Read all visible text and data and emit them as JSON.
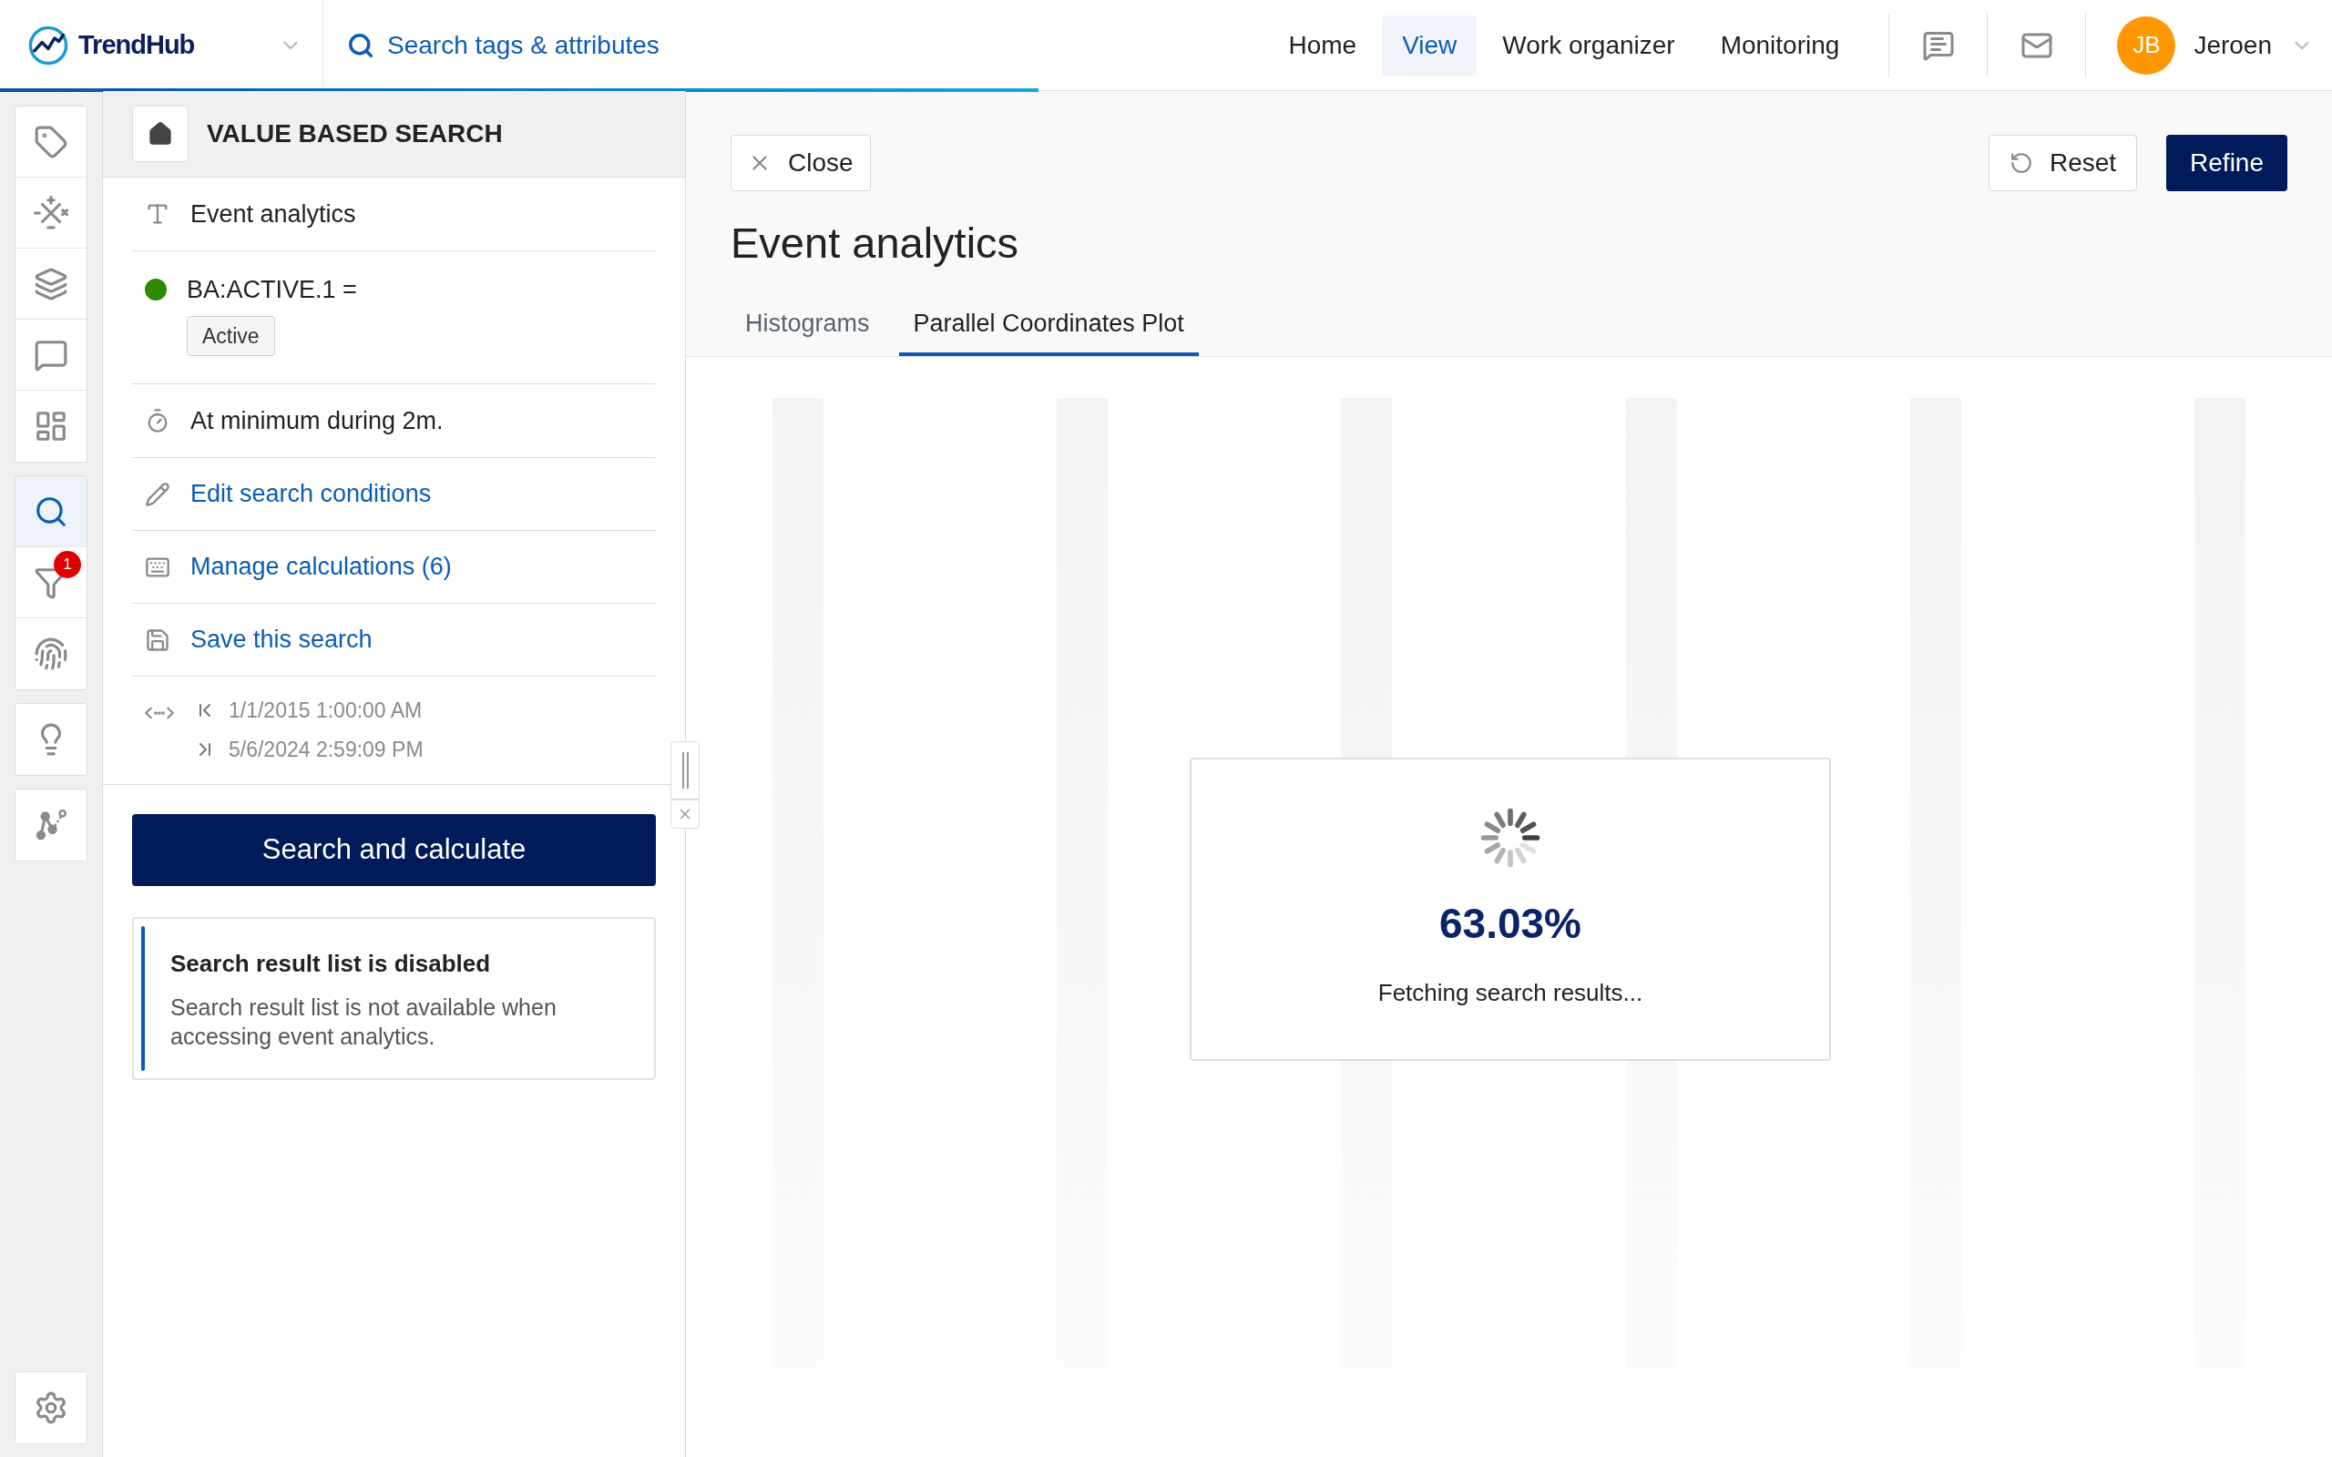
{
  "app": {
    "name": "TrendHub"
  },
  "search": {
    "placeholder": "Search tags & attributes"
  },
  "nav": [
    {
      "label": "Home",
      "selected": false
    },
    {
      "label": "View",
      "selected": true
    },
    {
      "label": "Work organizer",
      "selected": false
    },
    {
      "label": "Monitoring",
      "selected": false
    }
  ],
  "user": {
    "initials": "JB",
    "name": "Jeroen"
  },
  "sidebar": {
    "groups": [
      [
        {
          "kind": "tag",
          "selected": false
        },
        {
          "kind": "calculator",
          "selected": false
        },
        {
          "kind": "layers",
          "selected": false
        },
        {
          "kind": "comment",
          "selected": false
        },
        {
          "kind": "dashboard",
          "selected": false
        }
      ],
      [
        {
          "kind": "search",
          "selected": true
        },
        {
          "kind": "filter",
          "selected": false,
          "badge": "1"
        },
        {
          "kind": "fingerprint",
          "selected": false
        }
      ],
      [
        {
          "kind": "lightbulb",
          "selected": false
        }
      ],
      [
        {
          "kind": "graph",
          "selected": false
        }
      ]
    ],
    "footer": {
      "kind": "settings",
      "selected": false
    }
  },
  "panel": {
    "title": "VALUE BASED SEARCH",
    "items": [
      {
        "kind": "title",
        "text": "Event analytics"
      },
      {
        "kind": "condition",
        "color": "#2e8b00",
        "text": "BA:ACTIVE.1 =",
        "value": "Active"
      },
      {
        "kind": "duration",
        "text": "At minimum during 2m."
      },
      {
        "kind": "edit",
        "text": "Edit search conditions"
      },
      {
        "kind": "calculations",
        "text": "Manage calculations (6)"
      },
      {
        "kind": "save",
        "text": "Save this search"
      },
      {
        "kind": "range",
        "start": "1/1/2015 1:00:00 AM",
        "end": "5/6/2024 2:59:09 PM"
      }
    ],
    "primary_button": "Search and calculate",
    "notice": {
      "title": "Search result list is disabled",
      "text": "Search result list is not available when accessing event analytics."
    }
  },
  "analytics": {
    "close": "Close",
    "reset": "Reset",
    "refine": "Refine",
    "title": "Event analytics",
    "tabs": [
      {
        "label": "Histograms",
        "selected": false
      },
      {
        "label": "Parallel Coordinates Plot",
        "selected": true
      }
    ],
    "loading": {
      "percent": "63.03%",
      "message": "Fetching search results..."
    }
  }
}
